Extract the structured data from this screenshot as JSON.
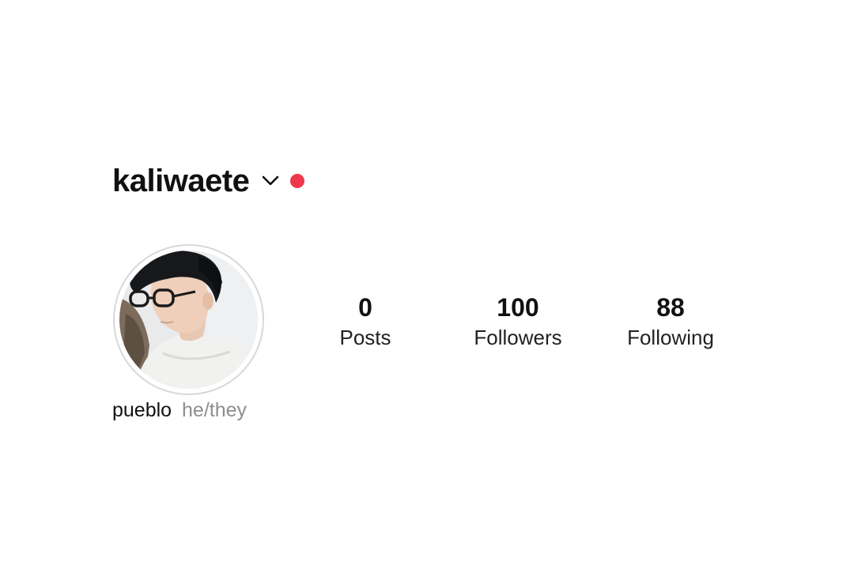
{
  "profile": {
    "username": "kaliwaete",
    "display_name": "pueblo",
    "pronouns": "he/they",
    "avatar_description": "profile-photo"
  },
  "stats": {
    "posts": {
      "count": "0",
      "label": "Posts"
    },
    "followers": {
      "count": "100",
      "label": "Followers"
    },
    "following": {
      "count": "88",
      "label": "Following"
    }
  },
  "icons": {
    "account_switcher": "chevron-down-icon",
    "notification": "notification-dot-icon"
  },
  "colors": {
    "notification_dot": "#f0384d",
    "primary_text": "#111111",
    "secondary_text": "#8e8e8e",
    "avatar_ring": "#d8d8d8"
  }
}
